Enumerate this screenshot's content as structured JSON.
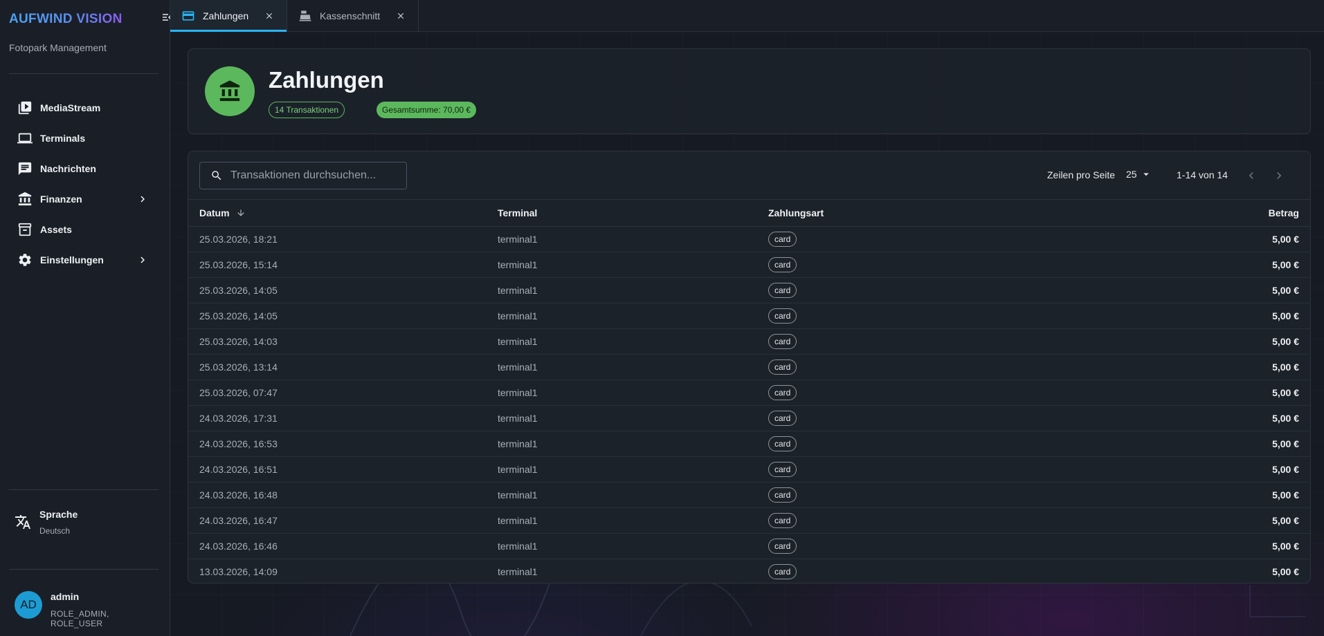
{
  "sidebar": {
    "brand": "AUFWIND VISION",
    "subtitle": "Fotopark Management",
    "items": [
      {
        "label": "MediaStream",
        "icon": "video-library-icon"
      },
      {
        "label": "Terminals",
        "icon": "laptop-icon"
      },
      {
        "label": "Nachrichten",
        "icon": "message-icon"
      },
      {
        "label": "Finanzen",
        "icon": "bank-icon",
        "expandable": true
      },
      {
        "label": "Assets",
        "icon": "archive-icon"
      },
      {
        "label": "Einstellungen",
        "icon": "gear-icon",
        "expandable": true
      }
    ],
    "language": {
      "label": "Sprache",
      "value": "Deutsch"
    },
    "user": {
      "initials": "AD",
      "name": "admin",
      "roles": "ROLE_ADMIN, ROLE_USER"
    }
  },
  "tabs": [
    {
      "label": "Zahlungen",
      "icon": "credit-card-icon",
      "active": true
    },
    {
      "label": "Kassenschnitt",
      "icon": "cash-register-icon",
      "active": false
    }
  ],
  "header": {
    "title": "Zahlungen",
    "count_badge": "14 Transaktionen",
    "sum_badge": "Gesamtsumme: 70,00 €"
  },
  "toolbar": {
    "search_placeholder": "Transaktionen durchsuchen...",
    "rows_per_page_label": "Zeilen pro Seite",
    "rows_per_page_value": "25",
    "range": "1-14 von 14"
  },
  "table": {
    "columns": {
      "date": "Datum",
      "terminal": "Terminal",
      "payment": "Zahlungsart",
      "amount": "Betrag"
    },
    "rows": [
      {
        "date": "25.03.2026, 18:21",
        "terminal": "terminal1",
        "payment": "card",
        "amount": "5,00 €"
      },
      {
        "date": "25.03.2026, 15:14",
        "terminal": "terminal1",
        "payment": "card",
        "amount": "5,00 €"
      },
      {
        "date": "25.03.2026, 14:05",
        "terminal": "terminal1",
        "payment": "card",
        "amount": "5,00 €"
      },
      {
        "date": "25.03.2026, 14:05",
        "terminal": "terminal1",
        "payment": "card",
        "amount": "5,00 €"
      },
      {
        "date": "25.03.2026, 14:03",
        "terminal": "terminal1",
        "payment": "card",
        "amount": "5,00 €"
      },
      {
        "date": "25.03.2026, 13:14",
        "terminal": "terminal1",
        "payment": "card",
        "amount": "5,00 €"
      },
      {
        "date": "25.03.2026, 07:47",
        "terminal": "terminal1",
        "payment": "card",
        "amount": "5,00 €"
      },
      {
        "date": "24.03.2026, 17:31",
        "terminal": "terminal1",
        "payment": "card",
        "amount": "5,00 €"
      },
      {
        "date": "24.03.2026, 16:53",
        "terminal": "terminal1",
        "payment": "card",
        "amount": "5,00 €"
      },
      {
        "date": "24.03.2026, 16:51",
        "terminal": "terminal1",
        "payment": "card",
        "amount": "5,00 €"
      },
      {
        "date": "24.03.2026, 16:48",
        "terminal": "terminal1",
        "payment": "card",
        "amount": "5,00 €"
      },
      {
        "date": "24.03.2026, 16:47",
        "terminal": "terminal1",
        "payment": "card",
        "amount": "5,00 €"
      },
      {
        "date": "24.03.2026, 16:46",
        "terminal": "terminal1",
        "payment": "card",
        "amount": "5,00 €"
      },
      {
        "date": "13.03.2026, 14:09",
        "terminal": "terminal1",
        "payment": "card",
        "amount": "5,00 €"
      }
    ]
  },
  "colors": {
    "accent": "#29b6f6",
    "success": "#5cb85c",
    "avatar": "#1d9cd3"
  }
}
